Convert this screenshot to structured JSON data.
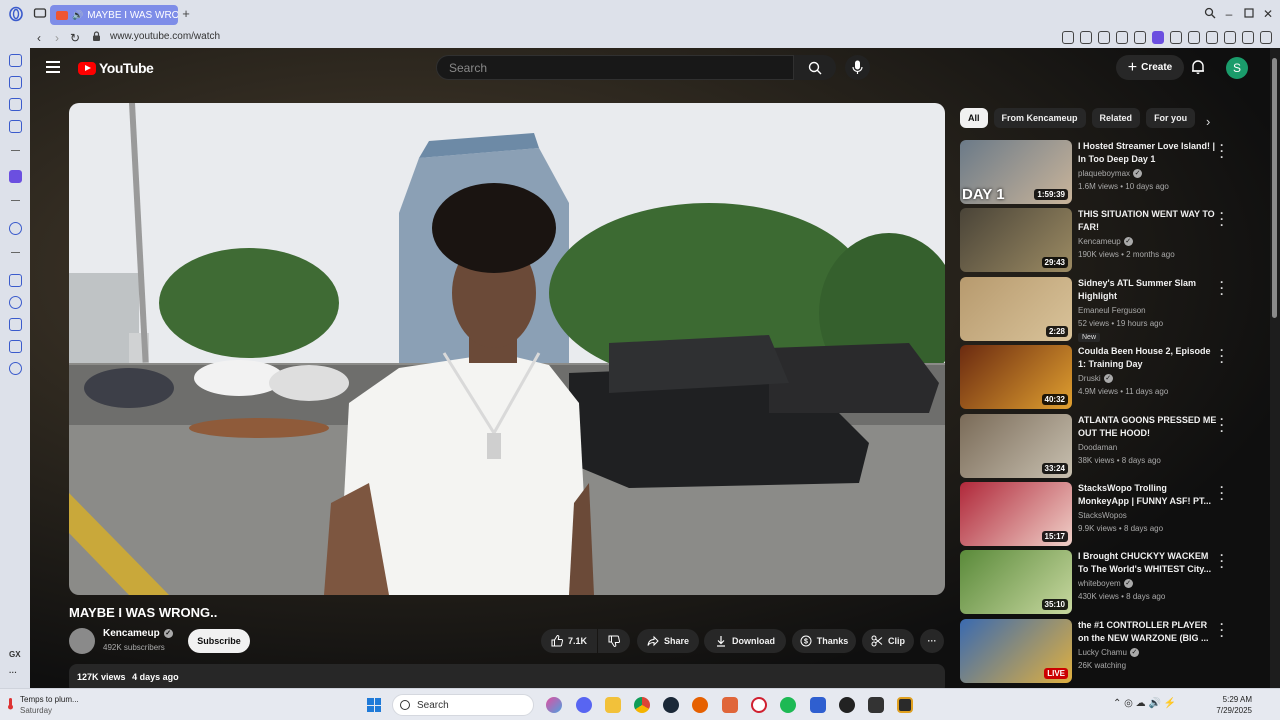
{
  "browser": {
    "tab_title": "MAYBE I WAS WRONG",
    "url": "www.youtube.com/watch"
  },
  "sidebar": {
    "bottom_label": "GX"
  },
  "youtube": {
    "logo": "YouTube",
    "search_placeholder": "Search",
    "create_label": "Create",
    "avatar_letter": "S"
  },
  "video": {
    "title": "MAYBE I WAS WRONG..",
    "channel": "Kencameup",
    "subscribers": "492K subscribers",
    "subscribe_label": "Subscribe",
    "likes": "7.1K",
    "share_label": "Share",
    "download_label": "Download",
    "thanks_label": "Thanks",
    "clip_label": "Clip",
    "more_label": "···",
    "views": "127K views",
    "age": "4 days ago"
  },
  "chips": [
    "All",
    "From Kencameup",
    "Related",
    "For you"
  ],
  "recommendations": [
    {
      "title": "I Hosted Streamer Love Island! | In Too Deep Day 1",
      "channel": "plaqueboymax",
      "verified": true,
      "views": "1.6M views",
      "age": "10 days ago",
      "duration": "1:59:39",
      "thumb_text": "DAY 1",
      "badge": "",
      "thumb_colors": [
        "#6b7a88",
        "#c9b49a"
      ]
    },
    {
      "title": "THIS SITUATION WENT WAY TO FAR!",
      "channel": "Kencameup",
      "verified": true,
      "views": "190K views",
      "age": "2 months ago",
      "duration": "29:43",
      "thumb_text": "",
      "badge": "",
      "thumb_colors": [
        "#4a4438",
        "#9c8b63"
      ]
    },
    {
      "title": "Sidney's ATL Summer Slam Highlight",
      "channel": "Emaneul Ferguson",
      "verified": false,
      "views": "52 views",
      "age": "19 hours ago",
      "duration": "2:28",
      "thumb_text": "",
      "badge": "New",
      "thumb_colors": [
        "#b79a6e",
        "#d9c39a"
      ]
    },
    {
      "title": "Coulda Been House 2, Episode 1: Training Day",
      "channel": "Druski",
      "verified": true,
      "views": "4.9M views",
      "age": "11 days ago",
      "duration": "40:32",
      "thumb_text": "",
      "badge": "",
      "thumb_colors": [
        "#6b2a10",
        "#e0a030"
      ]
    },
    {
      "title": "ATLANTA GOONS PRESSED ME OUT THE HOOD!",
      "channel": "Doodaman",
      "verified": false,
      "views": "38K views",
      "age": "8 days ago",
      "duration": "33:24",
      "thumb_text": "",
      "badge": "",
      "thumb_colors": [
        "#7a6b58",
        "#c8c0b0"
      ]
    },
    {
      "title": "StacksWopo Trolling MonkeyApp | FUNNY ASF! PT...",
      "channel": "StacksWopos",
      "verified": false,
      "views": "9.9K views",
      "age": "8 days ago",
      "duration": "15:17",
      "thumb_text": "",
      "badge": "",
      "thumb_colors": [
        "#b0283a",
        "#f0d0c8"
      ]
    },
    {
      "title": "I Brought CHUCKYY WACKEM To The World's WHITEST City...",
      "channel": "whiteboyem",
      "verified": true,
      "views": "430K views",
      "age": "8 days ago",
      "duration": "35:10",
      "thumb_text": "",
      "badge": "",
      "thumb_colors": [
        "#5a8a3a",
        "#c8d8a0"
      ]
    },
    {
      "title": "the #1 CONTROLLER PLAYER on the NEW WARZONE (BIG ...",
      "channel": "Lucky Chamu",
      "verified": true,
      "views": "26K watching",
      "age": "",
      "duration": "LIVE",
      "thumb_text": "",
      "badge": "",
      "thumb_colors": [
        "#3a6ab0",
        "#e0b040"
      ]
    }
  ],
  "taskbar": {
    "weather_line1": "Temps to plum...",
    "weather_line2": "Saturday",
    "search_label": "Search",
    "time": "5:29 AM",
    "date": "7/29/2025"
  }
}
